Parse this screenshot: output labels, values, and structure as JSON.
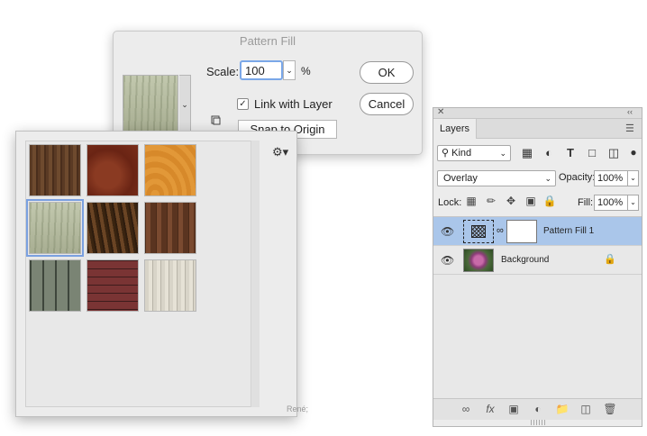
{
  "dialog": {
    "title": "Pattern Fill",
    "scale_label": "Scale:",
    "scale_value": "100",
    "scale_unit": "%",
    "ok": "OK",
    "cancel": "Cancel",
    "link_label": "Link with Layer",
    "link_checked": true,
    "snap_label": "Snap to Origin"
  },
  "picker": {
    "swatches": [
      {
        "name": "dark-walnut",
        "selected": false
      },
      {
        "name": "red-mahogany",
        "selected": false
      },
      {
        "name": "orange-pine",
        "selected": false
      },
      {
        "name": "pale-green-wood",
        "selected": true
      },
      {
        "name": "dark-grain",
        "selected": false
      },
      {
        "name": "brown-planks",
        "selected": false
      },
      {
        "name": "grey-green-planks",
        "selected": false
      },
      {
        "name": "red-planks",
        "selected": false
      },
      {
        "name": "white-weathered",
        "selected": false
      }
    ]
  },
  "layers": {
    "tab": "Layers",
    "kind": "Kind",
    "blend_mode": "Overlay",
    "opacity_label": "Opacity:",
    "opacity_value": "100%",
    "lock_label": "Lock:",
    "fill_label": "Fill:",
    "fill_value": "100%",
    "items": [
      {
        "name": "Pattern Fill 1",
        "selected": true,
        "visible": true
      },
      {
        "name": "Background",
        "selected": false,
        "visible": true,
        "locked": true
      }
    ]
  },
  "colors": {
    "selection": "#aac6ea",
    "focus_ring": "#7aa7e8",
    "panel_bg": "#ececec"
  }
}
